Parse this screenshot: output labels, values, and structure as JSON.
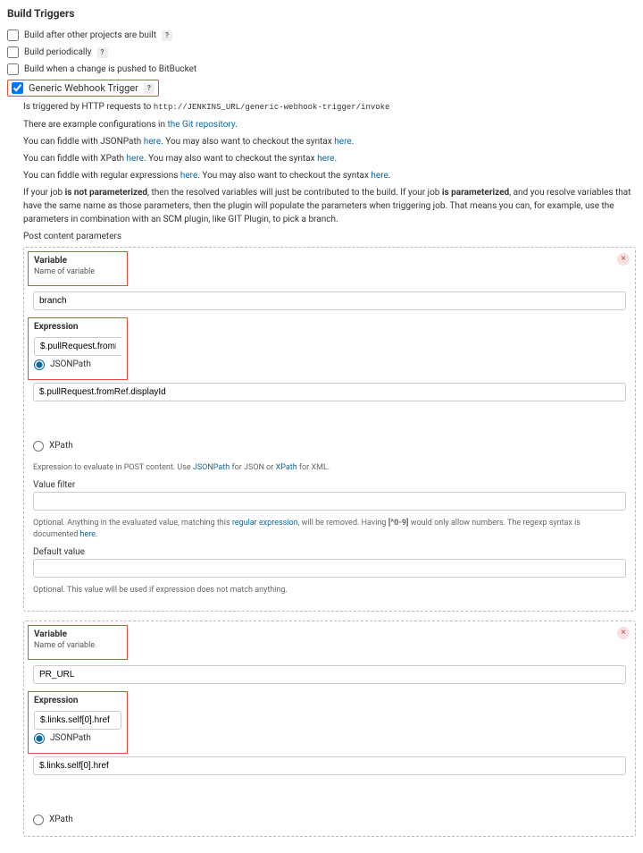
{
  "title": "Build Triggers",
  "triggers": {
    "afterOther": {
      "label": "Build after other projects are built",
      "checked": false
    },
    "periodically": {
      "label": "Build periodically",
      "checked": false
    },
    "bitbucket": {
      "label": "Build when a change is pushed to BitBucket",
      "checked": false
    },
    "generic": {
      "label": "Generic Webhook Trigger",
      "checked": true
    }
  },
  "generic": {
    "triggeredText": "Is triggered by HTTP requests to ",
    "url": "http://JENKINS_URL/generic-webhook-trigger/invoke",
    "exampleText": "There are example configurations in ",
    "exampleLink": "the Git repository",
    "fiddleJson1": "You can fiddle with JSONPath ",
    "fiddleJson2": ". You may also want to checkout the syntax ",
    "fiddleXpath1": "You can fiddle with XPath ",
    "fiddleXpath2": ". You may also want to checkout the syntax ",
    "fiddleRegex1": "You can fiddle with regular expressions ",
    "fiddleRegex2": ". You may also want to checkout the syntax ",
    "here": "here",
    "paramText1": "If your job ",
    "paramBold1": "is not parameterized",
    "paramText2": ", then the resolved variables will just be contributed to the build. If your job ",
    "paramBold2": "is parameterized",
    "paramText3": ", and you resolve variables that have the same name as those parameters, then the plugin will populate the parameters when triggering job. That means you can, for example, use the parameters in combination with an SCM plugin, like GIT Plugin, to pick a branch.",
    "postContentLabel": "Post content parameters"
  },
  "labels": {
    "variable": "Variable",
    "nameOfVariable": "Name of variable",
    "expression": "Expression",
    "jsonpath": "JSONPath",
    "xpath": "XPath",
    "valueFilter": "Value filter",
    "defaultValue": "Default value"
  },
  "hints": {
    "expressionHint1": "Expression to evaluate in POST content. Use ",
    "expressionHint2": " for JSON or ",
    "expressionHint3": " for XML.",
    "filterHint1": "Optional. Anything in the evaluated value, matching this ",
    "filterHintLink": "regular expression",
    "filterHint2": ", will be removed. Having ",
    "filterHintBold": "[^0-9]",
    "filterHint3": " would only allow numbers. The regexp syntax is documented ",
    "defaultHint": "Optional. This value will be used if expression does not match anything."
  },
  "params": [
    {
      "variableValue": "branch",
      "expressionValue": "$.pullRequest.fromRef.displayId",
      "jsonpathSelected": true,
      "showFull": true
    },
    {
      "variableValue": "PR_URL",
      "expressionValue": "$.links.self[0].href",
      "jsonpathSelected": true,
      "showFull": false
    }
  ],
  "helpGlyph": "?",
  "closeGlyph": "×"
}
